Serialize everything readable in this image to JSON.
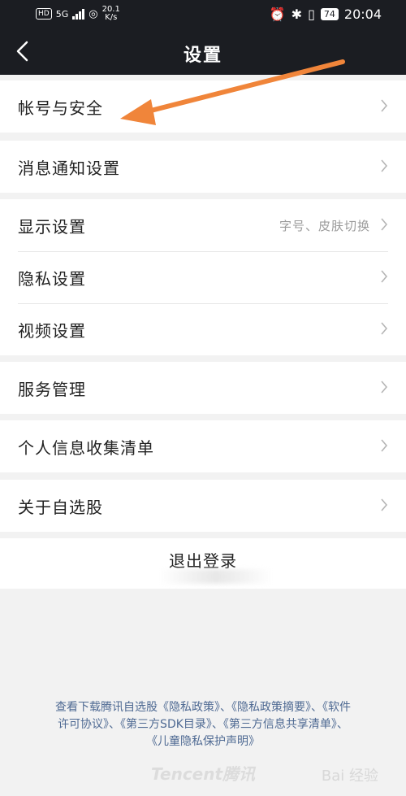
{
  "status_bar": {
    "left_badge": "HD",
    "network": "5G",
    "speed_value": "20.1",
    "speed_unit": "K/s",
    "battery": "74",
    "time": "20:04"
  },
  "header": {
    "title": "设置"
  },
  "groups": [
    {
      "items": [
        {
          "label": "帐号与安全"
        }
      ]
    },
    {
      "items": [
        {
          "label": "消息通知设置"
        }
      ]
    },
    {
      "items": [
        {
          "label": "显示设置",
          "subtitle": "字号、皮肤切换"
        },
        {
          "label": "隐私设置"
        },
        {
          "label": "视频设置"
        }
      ]
    },
    {
      "items": [
        {
          "label": "服务管理"
        }
      ]
    },
    {
      "items": [
        {
          "label": "个人信息收集清单"
        }
      ]
    },
    {
      "items": [
        {
          "label": "关于自选股"
        }
      ]
    }
  ],
  "logout_label": "退出登录",
  "footer": {
    "line1": "查看下载腾讯自选股《隐私政策》、《隐私政策摘要》、《软件",
    "line2": "许可协议》、《第三方SDK目录》、《第三方信息共享清单》、",
    "line3": "《儿童隐私保护声明》"
  },
  "brand": "Tencent腾讯",
  "watermark": "Bai 经验",
  "annotation_color": "#f0853a"
}
